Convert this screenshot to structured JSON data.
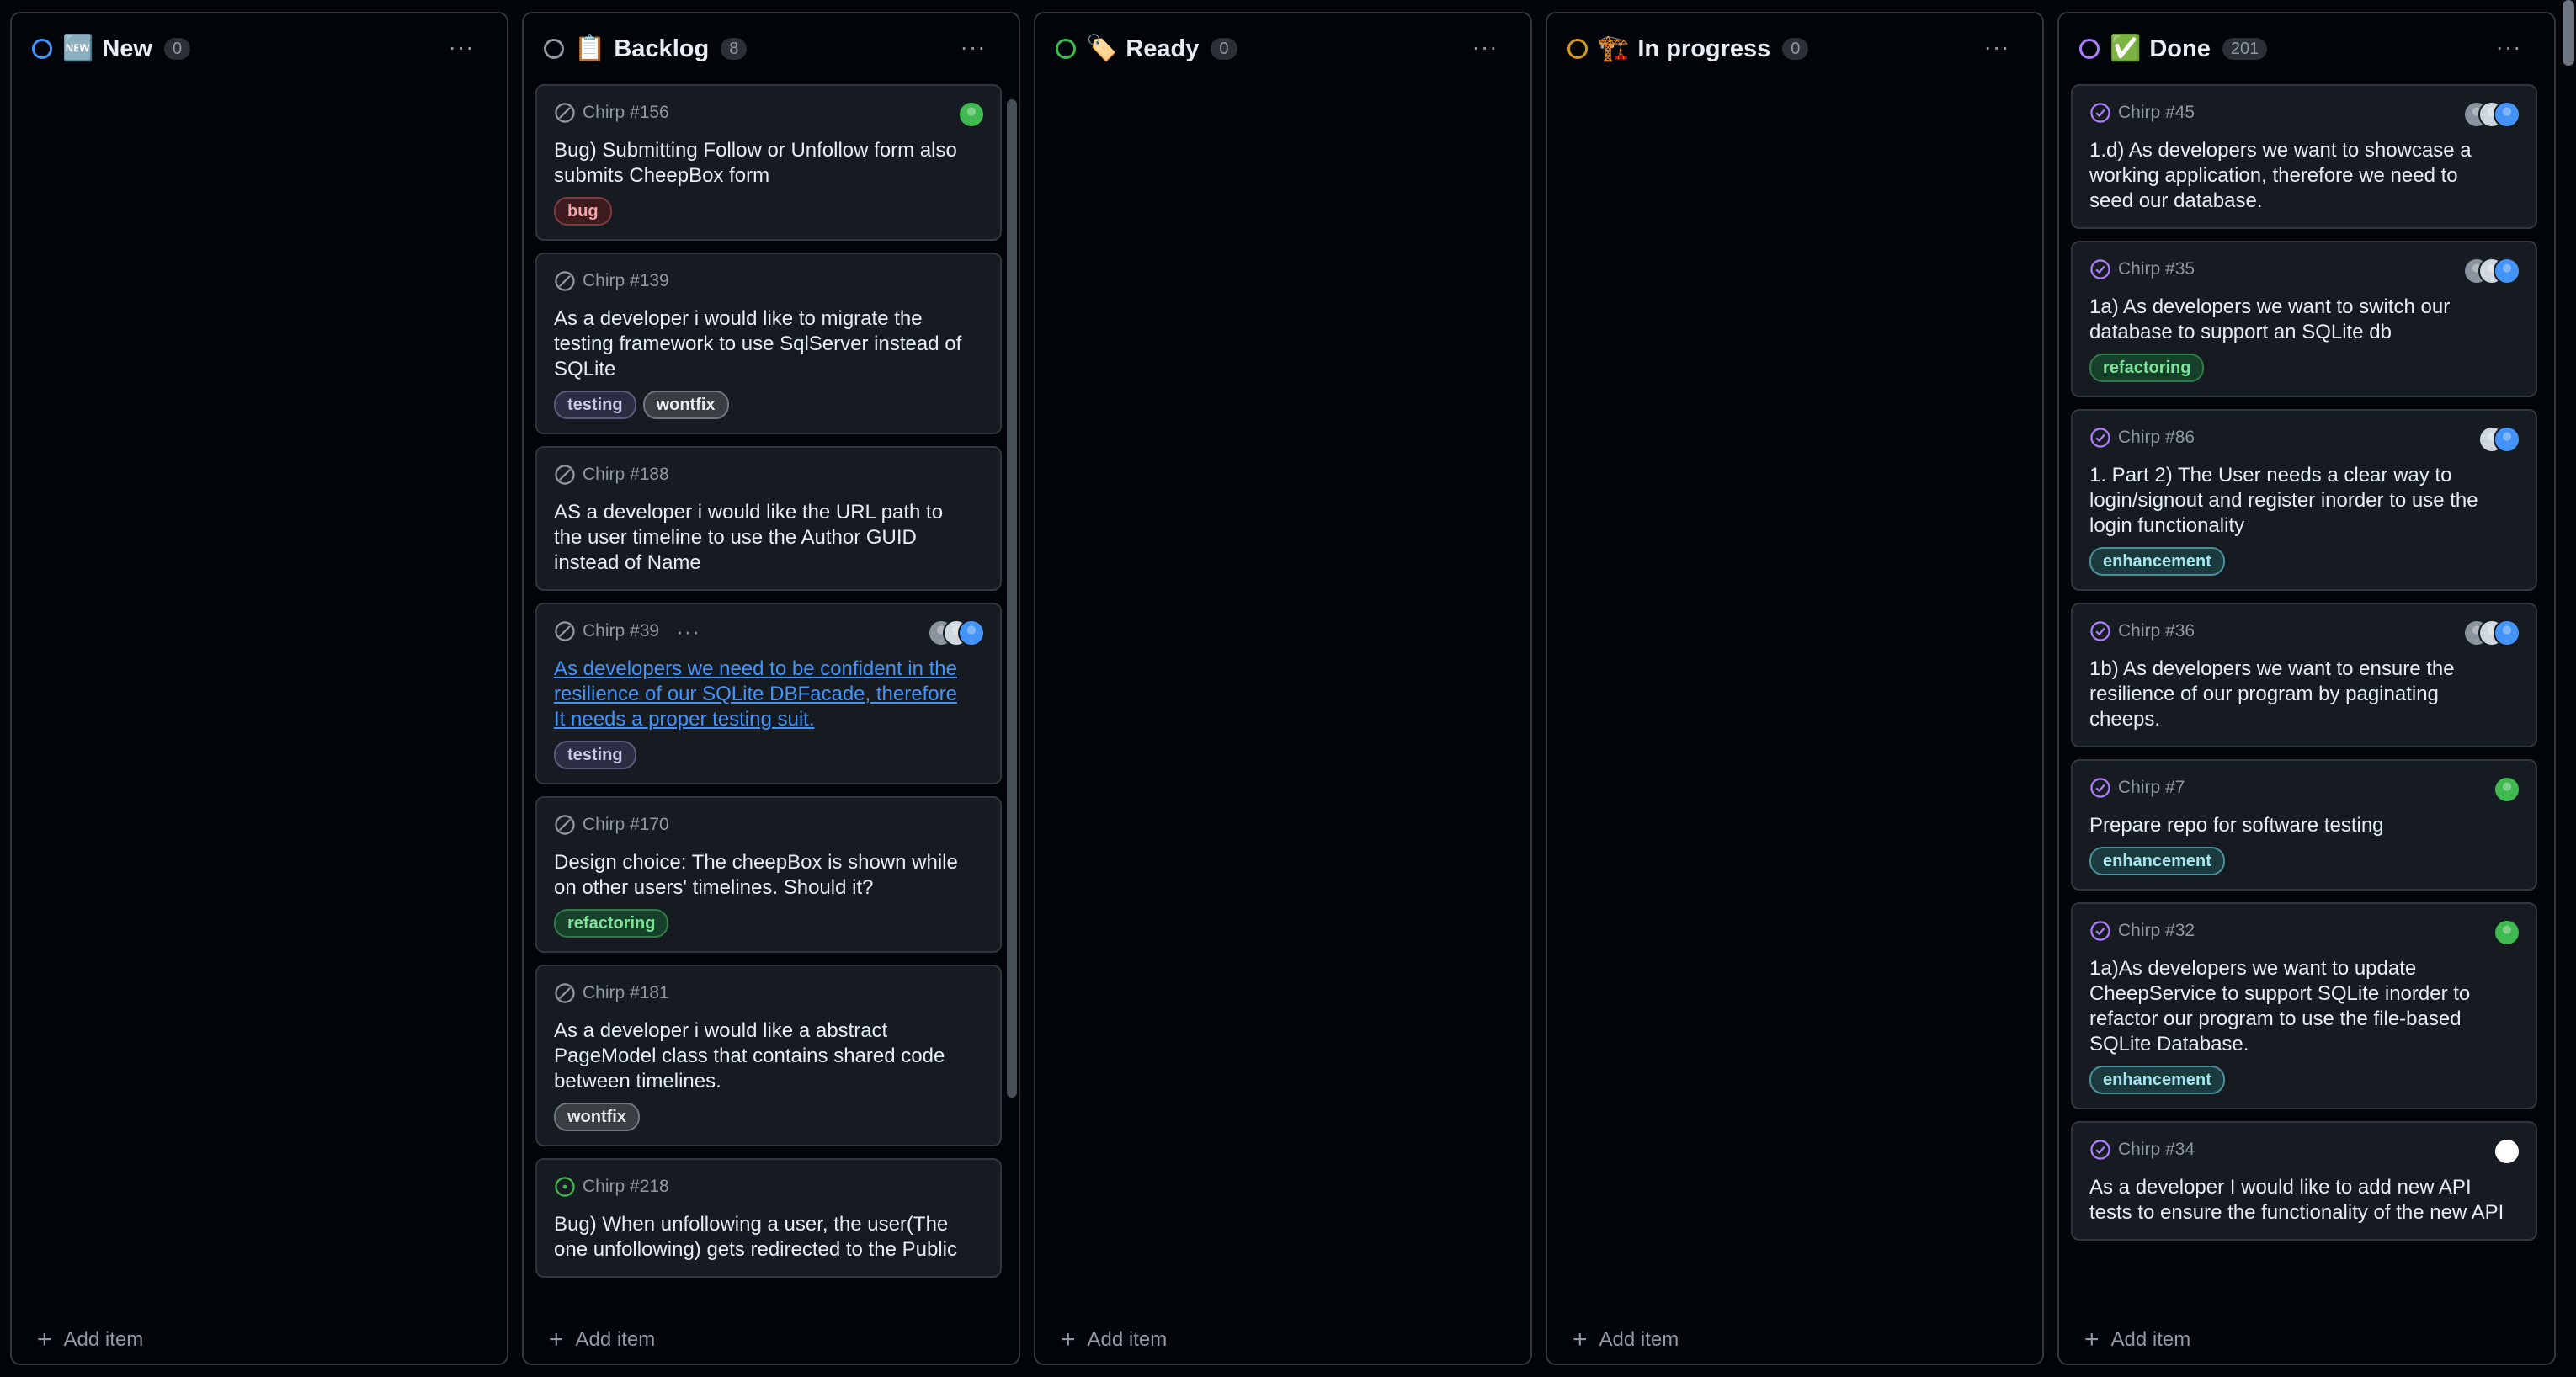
{
  "columns": [
    {
      "title": "New",
      "emoji": "🆕",
      "count": "0",
      "color": "#4493f8",
      "cards": [],
      "add_label": "Add item"
    },
    {
      "title": "Backlog",
      "emoji": "📋",
      "count": "8",
      "color": "#9198a1",
      "add_label": "Add item",
      "cards": [
        {
          "id": "Chirp #156",
          "title": "Bug) Submitting Follow or Unfollow form also submits CheepBox form",
          "labels": [
            {
              "name": "bug",
              "kind": "bug"
            }
          ],
          "state": "closed-grey",
          "avatars": [
            "#3fb950"
          ]
        },
        {
          "id": "Chirp #139",
          "title": "As a developer i would like to migrate the testing framework to use SqlServer instead of SQLite",
          "labels": [
            {
              "name": "testing",
              "kind": "testing"
            },
            {
              "name": "wontfix",
              "kind": "wontfix"
            }
          ],
          "state": "closed-grey",
          "avatars": []
        },
        {
          "id": "Chirp #188",
          "title": "AS a developer i would like the URL path to the user timeline to use the Author GUID instead of Name",
          "labels": [],
          "state": "closed-grey",
          "avatars": []
        },
        {
          "id": "Chirp #39",
          "title": "As developers we need to be confident in the resilience of our SQLite DBFacade, therefore It needs a proper testing suit.",
          "labels": [
            {
              "name": "testing",
              "kind": "testing"
            }
          ],
          "state": "closed-grey",
          "avatars": [
            "#8b949e",
            "#d0d7de",
            "#4493f8"
          ],
          "link": true,
          "more": "···"
        },
        {
          "id": "Chirp #170",
          "title": "Design choice: The cheepBox is shown while on other users' timelines. Should it?",
          "labels": [
            {
              "name": "refactoring",
              "kind": "refactoring"
            }
          ],
          "state": "closed-grey",
          "avatars": []
        },
        {
          "id": "Chirp #181",
          "title": "As a developer i would like a abstract PageModel class that contains shared code between timelines.",
          "labels": [
            {
              "name": "wontfix",
              "kind": "wontfix"
            }
          ],
          "state": "closed-grey",
          "avatars": []
        },
        {
          "id": "Chirp #218",
          "title": "Bug) When unfollowing a user, the user(The one unfollowing) gets redirected to the Public",
          "labels": [],
          "state": "open",
          "avatars": []
        }
      ]
    },
    {
      "title": "Ready",
      "emoji": "🏷️",
      "count": "0",
      "color": "#3fb950",
      "cards": [],
      "add_label": "Add item"
    },
    {
      "title": "In progress",
      "emoji": "🏗️",
      "count": "0",
      "color": "#d29922",
      "cards": [],
      "add_label": "Add item"
    },
    {
      "title": "Done",
      "emoji": "✅",
      "count": "201",
      "color": "#ab7df8",
      "add_label": "Add item",
      "cards": [
        {
          "id": "Chirp #45",
          "title": "1.d) As developers we want to showcase a working application, therefore we need to seed our database.",
          "labels": [],
          "state": "done",
          "avatars": [
            "#8b949e",
            "#d0d7de",
            "#4493f8"
          ]
        },
        {
          "id": "Chirp #35",
          "title": "1a) As developers we want to switch our database to support an SQLite db",
          "labels": [
            {
              "name": "refactoring",
              "kind": "refactoring"
            }
          ],
          "state": "done",
          "avatars": [
            "#8b949e",
            "#d0d7de",
            "#4493f8"
          ]
        },
        {
          "id": "Chirp #86",
          "title": "1. Part 2) The User needs a clear way to login/signout and register inorder to use the login functionality",
          "labels": [
            {
              "name": "enhancement",
              "kind": "enhancement"
            }
          ],
          "state": "done",
          "avatars": [
            "#d0d7de",
            "#4493f8"
          ]
        },
        {
          "id": "Chirp #36",
          "title": "1b) As developers we want to ensure the resilience of our program by paginating cheeps.",
          "labels": [],
          "state": "done",
          "avatars": [
            "#8b949e",
            "#d0d7de",
            "#4493f8"
          ]
        },
        {
          "id": "Chirp #7",
          "title": "Prepare repo for software testing",
          "labels": [
            {
              "name": "enhancement",
              "kind": "enhancement"
            }
          ],
          "state": "done",
          "avatars": [
            "#3fb950"
          ]
        },
        {
          "id": "Chirp #32",
          "title": "1a)As developers we want to update CheepService to support SQLite inorder to refactor our program to use the file-based SQLite Database.",
          "labels": [
            {
              "name": "enhancement",
              "kind": "enhancement"
            }
          ],
          "state": "done",
          "avatars": [
            "#3fb950"
          ]
        },
        {
          "id": "Chirp #34",
          "title": "As a developer I would like to add new API tests to ensure the functionality of the new API",
          "labels": [],
          "state": "done",
          "avatars": [
            "#ffffff"
          ]
        }
      ]
    }
  ]
}
